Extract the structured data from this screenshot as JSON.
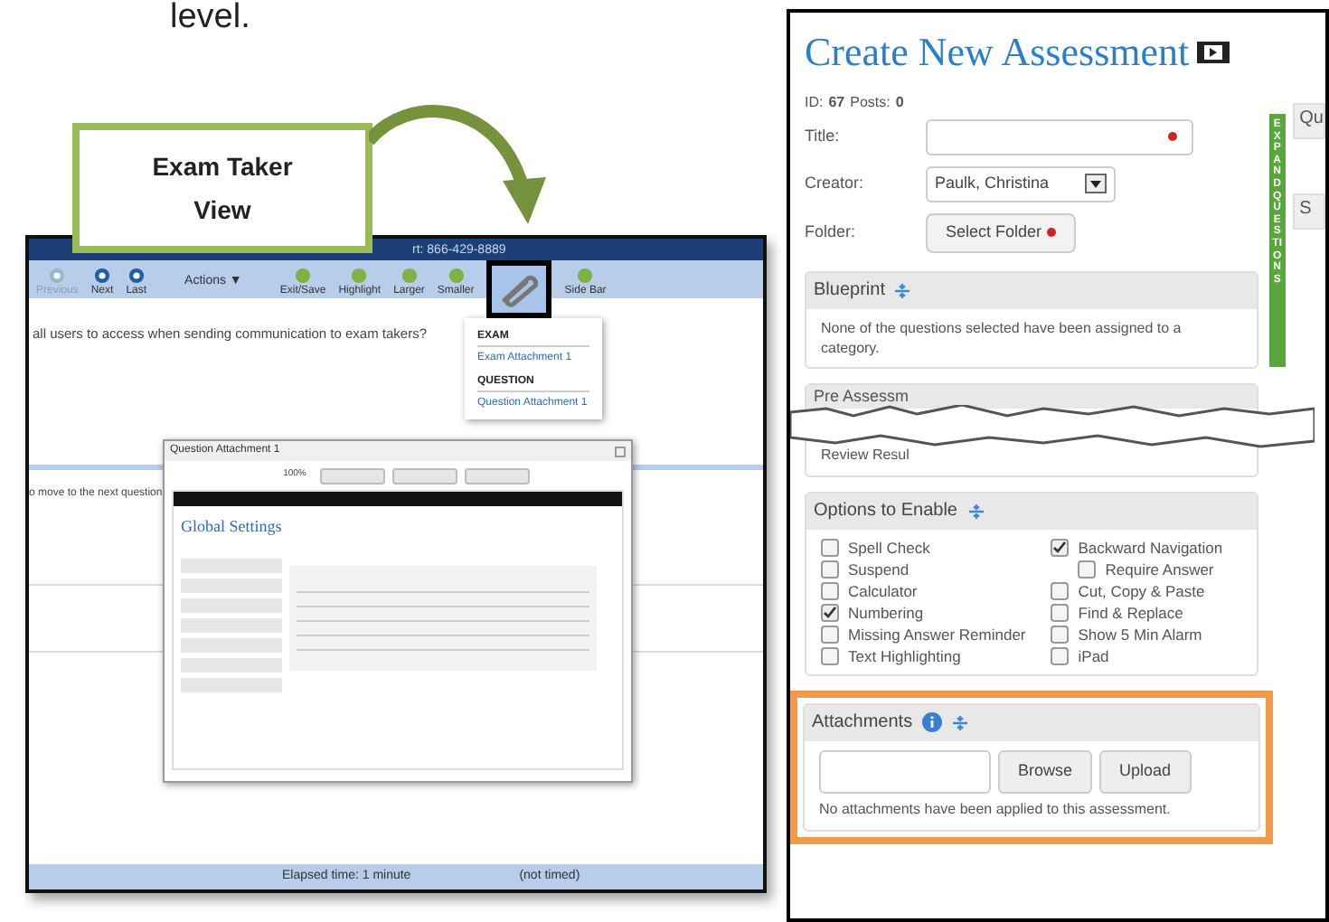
{
  "intro_text": "level.",
  "callout": {
    "label": "Exam Taker View"
  },
  "exam_window": {
    "title": "rt: 866-429-8889",
    "toolbar": [
      {
        "kind": "nav",
        "label": "Previous",
        "disabled": true
      },
      {
        "kind": "nav",
        "label": "Next",
        "disabled": false
      },
      {
        "kind": "nav",
        "label": "Last",
        "disabled": false
      },
      {
        "kind": "menu",
        "label": "Actions ▼"
      },
      {
        "kind": "tool",
        "label": "Exit/Save"
      },
      {
        "kind": "tool",
        "label": "Highlight"
      },
      {
        "kind": "tool",
        "label": "Larger"
      },
      {
        "kind": "tool",
        "label": "Smaller"
      },
      {
        "kind": "attach"
      },
      {
        "kind": "tool",
        "label": "Side Bar"
      }
    ],
    "question": "all users to access when sending communication to exam takers?",
    "attachment_menu": [
      {
        "kind": "heading",
        "text": "EXAM"
      },
      {
        "kind": "link",
        "text": "Exam Attachment 1"
      },
      {
        "kind": "heading",
        "text": "QUESTION"
      },
      {
        "kind": "link",
        "text": "Question Attachment 1"
      }
    ],
    "next_hint": "o move to the next question",
    "dialog": {
      "title": "Question Attachment 1",
      "zoom": "100%",
      "embedded_title": "Global Settings"
    },
    "status_bar": {
      "elapsed": "Elapsed time: 1 minute",
      "timing": "(not timed)"
    }
  },
  "assessment_form": {
    "title": "Create New Assessment",
    "id_label": "ID:",
    "id": "67",
    "posts_label": "Posts:",
    "posts": "0",
    "fields": [
      {
        "kind": "text",
        "label": "Title:",
        "required": true
      },
      {
        "kind": "select",
        "label": "Creator:",
        "value": "Paulk, Christina"
      },
      {
        "kind": "button",
        "label": "Folder:",
        "value": "Select Folder",
        "required": true
      }
    ],
    "expand_tab": "EXPAND QUESTIONS",
    "side_stubs": [
      "Qu",
      "S"
    ],
    "blueprint": {
      "title": "Blueprint",
      "text": "None of the questions selected have been assigned to a category."
    },
    "torn_section": {
      "title": "Pre Assessm",
      "text": "Review Resul"
    },
    "options": {
      "title": "Options to Enable",
      "left": [
        {
          "label": "Spell Check",
          "checked": false
        },
        {
          "label": "Suspend",
          "checked": false
        },
        {
          "label": "Calculator",
          "checked": false
        },
        {
          "label": "Numbering",
          "checked": true
        },
        {
          "label": "Missing Answer Reminder",
          "checked": false
        },
        {
          "label": "Text Highlighting",
          "checked": false
        }
      ],
      "right": [
        {
          "label": "Backward Navigation",
          "checked": true,
          "children": [
            {
              "label": "Require Answer",
              "checked": false
            }
          ]
        },
        {
          "label": "Cut, Copy & Paste",
          "checked": false
        },
        {
          "label": "Find & Replace",
          "checked": false
        },
        {
          "label": "Show 5 Min Alarm",
          "checked": false
        },
        {
          "label": "iPad",
          "checked": false
        }
      ]
    },
    "attachments": {
      "title": "Attachments",
      "browse": "Browse",
      "upload": "Upload",
      "message": "No attachments have been applied to this assessment.",
      "highlighted": true
    }
  }
}
